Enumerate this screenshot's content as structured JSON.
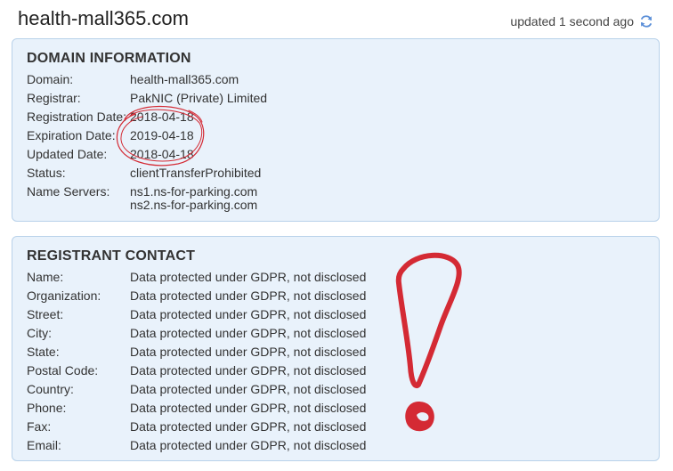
{
  "page": {
    "domain_title": "health-mall365.com",
    "updated_text": "updated 1 second ago",
    "refresh_icon": "refresh-icon",
    "accent_color": "#5b8fd8"
  },
  "domain_info": {
    "heading": "DOMAIN INFORMATION",
    "rows": [
      {
        "label": "Domain:",
        "value": "health-mall365.com"
      },
      {
        "label": "Registrar:",
        "value": "PakNIC (Private) Limited"
      },
      {
        "label": "Registration Date:",
        "value": "2018-04-18"
      },
      {
        "label": "Expiration Date:",
        "value": "2019-04-18"
      },
      {
        "label": "Updated Date:",
        "value": "2018-04-18"
      },
      {
        "label": "Status:",
        "value": "clientTransferProhibited"
      }
    ],
    "name_servers": {
      "label": "Name Servers:",
      "values": [
        "ns1.ns-for-parking.com",
        "ns2.ns-for-parking.com"
      ]
    }
  },
  "registrant": {
    "heading": "REGISTRANT CONTACT",
    "rows": [
      {
        "label": "Name:",
        "value": "Data protected under GDPR, not disclosed"
      },
      {
        "label": "Organization:",
        "value": "Data protected under GDPR, not disclosed"
      },
      {
        "label": "Street:",
        "value": "Data protected under GDPR, not disclosed"
      },
      {
        "label": "City:",
        "value": "Data protected under GDPR, not disclosed"
      },
      {
        "label": "State:",
        "value": "Data protected under GDPR, not disclosed"
      },
      {
        "label": "Postal Code:",
        "value": "Data protected under GDPR, not disclosed"
      },
      {
        "label": "Country:",
        "value": "Data protected under GDPR, not disclosed"
      },
      {
        "label": "Phone:",
        "value": "Data protected under GDPR, not disclosed"
      },
      {
        "label": "Fax:",
        "value": "Data protected under GDPR, not disclosed"
      },
      {
        "label": "Email:",
        "value": "Data protected under GDPR, not disclosed"
      }
    ]
  },
  "annotations": {
    "ink_color": "#d42a34",
    "circle_mark": "hand-drawn-circle",
    "exclamation_mark": "hand-drawn-exclamation"
  }
}
